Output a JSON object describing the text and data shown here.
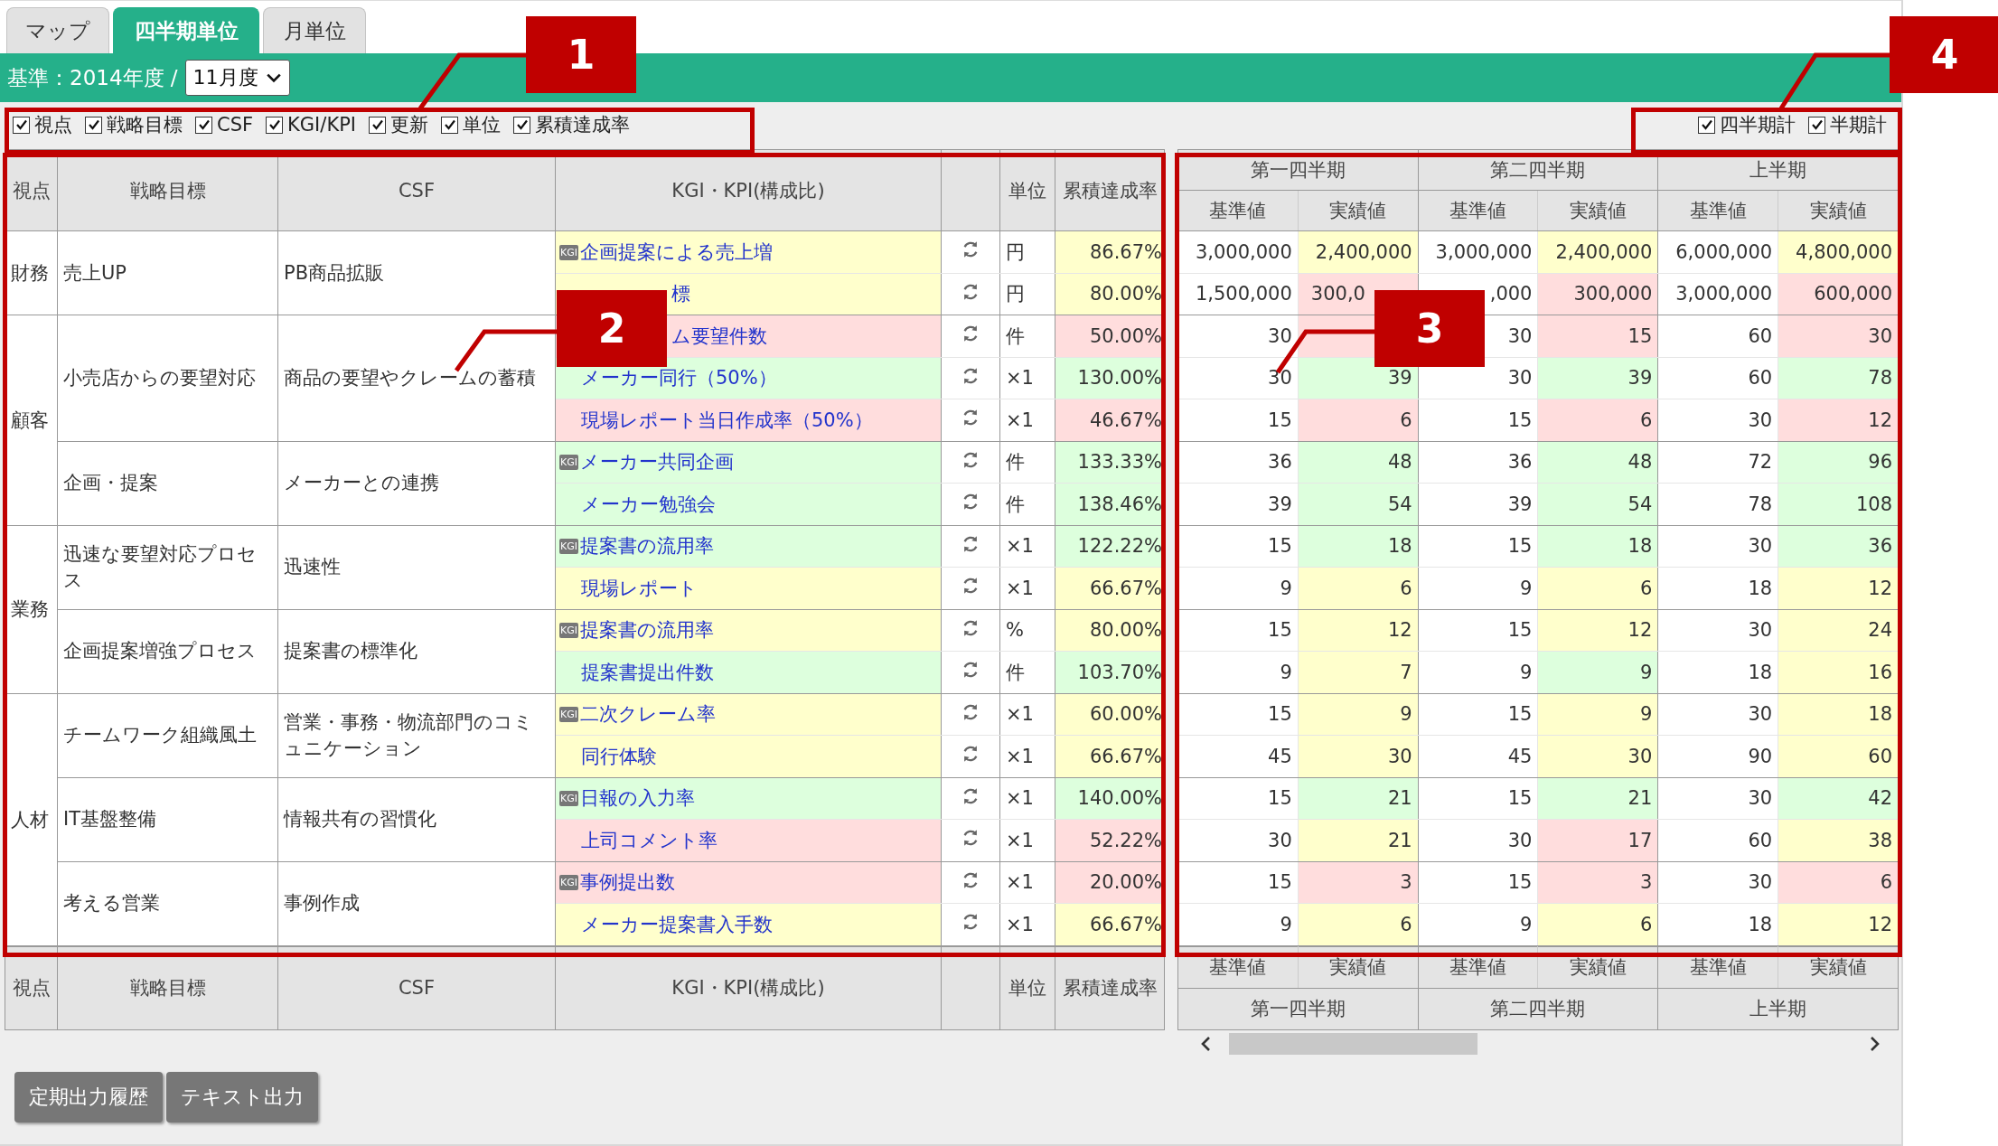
{
  "tabs": [
    {
      "label": "マップ",
      "selected": false
    },
    {
      "label": "四半期単位",
      "selected": true
    },
    {
      "label": "月単位",
      "selected": false
    }
  ],
  "basis": {
    "label": "基準：2014年度 /",
    "month": "11月度"
  },
  "display_options": [
    {
      "label": "視点",
      "checked": true
    },
    {
      "label": "戦略目標",
      "checked": true
    },
    {
      "label": "CSF",
      "checked": true
    },
    {
      "label": "KGI/KPI",
      "checked": true
    },
    {
      "label": "更新",
      "checked": true
    },
    {
      "label": "単位",
      "checked": true
    },
    {
      "label": "累積達成率",
      "checked": true
    }
  ],
  "total_options": [
    {
      "label": "四半期計",
      "checked": true
    },
    {
      "label": "半期計",
      "checked": true
    }
  ],
  "table": {
    "columns": [
      "視点",
      "戦略目標",
      "CSF",
      "KGI・KPI(構成比)",
      "単位",
      "累積達成率"
    ],
    "periods": [
      {
        "name": "第一四半期",
        "subcolumns": [
          "基準値",
          "実績値"
        ]
      },
      {
        "name": "第二四半期",
        "subcolumns": [
          "基準値",
          "実績値"
        ]
      },
      {
        "name": "上半期",
        "subcolumns": [
          "基準値",
          "実績値"
        ]
      }
    ],
    "perspectives": [
      {
        "name": "財務",
        "objectives": [
          {
            "name": "売上UP",
            "csf": "PB商品拡販",
            "kpis": [
              {
                "badge": "KGI",
                "name": "企画提案による売上増",
                "color": "#ffffcc",
                "unit": "円",
                "rate": "86.67%",
                "values": [
                  {
                    "text": "3,000,000"
                  },
                  {
                    "text": "2,400,000",
                    "color": "#ffffcc"
                  },
                  {
                    "text": "3,000,000"
                  },
                  {
                    "text": "2,400,000",
                    "color": "#ffffcc"
                  },
                  {
                    "text": "6,000,000"
                  },
                  {
                    "text": "4,800,000",
                    "color": "#ffffcc"
                  }
                ]
              },
              {
                "name": "標",
                "obscured": true,
                "color": "#ffffcc",
                "unit": "円",
                "rate": "80.00%",
                "values": [
                  {
                    "text": "1,500,000"
                  },
                  {
                    "text": "300,0",
                    "obscured": true,
                    "color": "#ffdddd"
                  },
                  {
                    "text": ",000"
                  },
                  {
                    "text": "300,000",
                    "color": "#ffdddd"
                  },
                  {
                    "text": "3,000,000"
                  },
                  {
                    "text": "600,000",
                    "color": "#ffdddd"
                  }
                ]
              }
            ]
          }
        ]
      },
      {
        "name": "顧客",
        "objectives": [
          {
            "name": "小売店からの要望対応",
            "csf": "商品の要望やクレームの蓄積",
            "kpis": [
              {
                "name": "ム要望件数",
                "obscured": true,
                "color": "#ffdddd",
                "unit": "件",
                "rate": "50.00%",
                "values": [
                  {
                    "text": "30"
                  },
                  {
                    "color": "#ffdddd"
                  },
                  {
                    "text": "30"
                  },
                  {
                    "text": "15",
                    "color": "#ffdddd"
                  },
                  {
                    "text": "60"
                  },
                  {
                    "text": "30",
                    "color": "#ffdddd"
                  }
                ]
              },
              {
                "name": "メーカー同行（50%）",
                "color": "#ddffdd",
                "unit": "×1",
                "rate": "130.00%",
                "values": [
                  {
                    "text": "30"
                  },
                  {
                    "text": "39",
                    "color": "#ddffdd"
                  },
                  {
                    "text": "30"
                  },
                  {
                    "text": "39",
                    "color": "#ddffdd"
                  },
                  {
                    "text": "60"
                  },
                  {
                    "text": "78",
                    "color": "#ddffdd"
                  }
                ]
              },
              {
                "name": "現場レポート当日作成率（50%）",
                "color": "#ffdddd",
                "unit": "×1",
                "rate": "46.67%",
                "values": [
                  {
                    "text": "15"
                  },
                  {
                    "text": "6",
                    "color": "#ffdddd"
                  },
                  {
                    "text": "15"
                  },
                  {
                    "text": "6",
                    "color": "#ffdddd"
                  },
                  {
                    "text": "30"
                  },
                  {
                    "text": "12",
                    "color": "#ffdddd"
                  }
                ]
              }
            ]
          },
          {
            "name": "企画・提案",
            "csf": "メーカーとの連携",
            "kpis": [
              {
                "badge": "KGI",
                "name": "メーカー共同企画",
                "color": "#ddffdd",
                "unit": "件",
                "rate": "133.33%",
                "values": [
                  {
                    "text": "36"
                  },
                  {
                    "text": "48",
                    "color": "#ddffdd"
                  },
                  {
                    "text": "36"
                  },
                  {
                    "text": "48",
                    "color": "#ddffdd"
                  },
                  {
                    "text": "72"
                  },
                  {
                    "text": "96",
                    "color": "#ddffdd"
                  }
                ]
              },
              {
                "name": "メーカー勉強会",
                "color": "#ddffdd",
                "unit": "件",
                "rate": "138.46%",
                "values": [
                  {
                    "text": "39"
                  },
                  {
                    "text": "54",
                    "color": "#ddffdd"
                  },
                  {
                    "text": "39"
                  },
                  {
                    "text": "54",
                    "color": "#ddffdd"
                  },
                  {
                    "text": "78"
                  },
                  {
                    "text": "108",
                    "color": "#ddffdd"
                  }
                ]
              }
            ]
          }
        ]
      },
      {
        "name": "業務",
        "objectives": [
          {
            "name": "迅速な要望対応プロセス",
            "csf": "迅速性",
            "kpis": [
              {
                "badge": "KGI",
                "name": "提案書の流用率",
                "color": "#ddffdd",
                "unit": "×1",
                "rate": "122.22%",
                "values": [
                  {
                    "text": "15"
                  },
                  {
                    "text": "18",
                    "color": "#ddffdd"
                  },
                  {
                    "text": "15"
                  },
                  {
                    "text": "18",
                    "color": "#ddffdd"
                  },
                  {
                    "text": "30"
                  },
                  {
                    "text": "36",
                    "color": "#ddffdd"
                  }
                ]
              },
              {
                "name": "現場レポート",
                "color": "#ffffcc",
                "unit": "×1",
                "rate": "66.67%",
                "values": [
                  {
                    "text": "9"
                  },
                  {
                    "text": "6",
                    "color": "#ffffcc"
                  },
                  {
                    "text": "9"
                  },
                  {
                    "text": "6",
                    "color": "#ffffcc"
                  },
                  {
                    "text": "18"
                  },
                  {
                    "text": "12",
                    "color": "#ffffcc"
                  }
                ]
              }
            ]
          },
          {
            "name": "企画提案増強プロセス",
            "csf": "提案書の標準化",
            "kpis": [
              {
                "badge": "KGI",
                "name": "提案書の流用率",
                "color": "#ffffcc",
                "unit": "%",
                "rate": "80.00%",
                "values": [
                  {
                    "text": "15"
                  },
                  {
                    "text": "12",
                    "color": "#ffffcc"
                  },
                  {
                    "text": "15"
                  },
                  {
                    "text": "12",
                    "color": "#ffffcc"
                  },
                  {
                    "text": "30"
                  },
                  {
                    "text": "24",
                    "color": "#ffffcc"
                  }
                ]
              },
              {
                "name": "提案書提出件数",
                "color": "#ddffdd",
                "unit": "件",
                "rate": "103.70%",
                "values": [
                  {
                    "text": "9"
                  },
                  {
                    "text": "7",
                    "color": "#ffffcc"
                  },
                  {
                    "text": "9"
                  },
                  {
                    "text": "9",
                    "color": "#ddffdd"
                  },
                  {
                    "text": "18"
                  },
                  {
                    "text": "16",
                    "color": "#ffffcc"
                  }
                ]
              }
            ]
          }
        ]
      },
      {
        "name": "人材",
        "objectives": [
          {
            "name": "チームワーク組織風土",
            "csf": "営業・事務・物流部門のコミュニケーション",
            "kpis": [
              {
                "badge": "KGI",
                "name": "二次クレーム率",
                "color": "#ffffcc",
                "unit": "×1",
                "rate": "60.00%",
                "values": [
                  {
                    "text": "15"
                  },
                  {
                    "text": "9",
                    "color": "#ffffcc"
                  },
                  {
                    "text": "15"
                  },
                  {
                    "text": "9",
                    "color": "#ffffcc"
                  },
                  {
                    "text": "30"
                  },
                  {
                    "text": "18",
                    "color": "#ffffcc"
                  }
                ]
              },
              {
                "name": "同行体験",
                "color": "#ffffcc",
                "unit": "×1",
                "rate": "66.67%",
                "values": [
                  {
                    "text": "45"
                  },
                  {
                    "text": "30",
                    "color": "#ffffcc"
                  },
                  {
                    "text": "45"
                  },
                  {
                    "text": "30",
                    "color": "#ffffcc"
                  },
                  {
                    "text": "90"
                  },
                  {
                    "text": "60",
                    "color": "#ffffcc"
                  }
                ]
              }
            ]
          },
          {
            "name": "IT基盤整備",
            "csf": "情報共有の習慣化",
            "kpis": [
              {
                "badge": "KGI",
                "name": "日報の入力率",
                "color": "#ddffdd",
                "unit": "×1",
                "rate": "140.00%",
                "values": [
                  {
                    "text": "15"
                  },
                  {
                    "text": "21",
                    "color": "#ddffdd"
                  },
                  {
                    "text": "15"
                  },
                  {
                    "text": "21",
                    "color": "#ddffdd"
                  },
                  {
                    "text": "30"
                  },
                  {
                    "text": "42",
                    "color": "#ddffdd"
                  }
                ]
              },
              {
                "name": "上司コメント率",
                "color": "#ffdddd",
                "unit": "×1",
                "rate": "52.22%",
                "values": [
                  {
                    "text": "30"
                  },
                  {
                    "text": "21",
                    "color": "#ffffcc"
                  },
                  {
                    "text": "30"
                  },
                  {
                    "text": "17",
                    "color": "#ffdddd"
                  },
                  {
                    "text": "60"
                  },
                  {
                    "text": "38",
                    "color": "#ffffcc"
                  }
                ]
              }
            ]
          },
          {
            "name": "考える営業",
            "csf": "事例作成",
            "kpis": [
              {
                "badge": "KGI",
                "name": "事例提出数",
                "color": "#ffdddd",
                "unit": "×1",
                "rate": "20.00%",
                "values": [
                  {
                    "text": "15"
                  },
                  {
                    "text": "3",
                    "color": "#ffdddd"
                  },
                  {
                    "text": "15"
                  },
                  {
                    "text": "3",
                    "color": "#ffdddd"
                  },
                  {
                    "text": "30"
                  },
                  {
                    "text": "6",
                    "color": "#ffdddd"
                  }
                ]
              },
              {
                "name": "メーカー提案書入手数",
                "color": "#ffffcc",
                "unit": "×1",
                "rate": "66.67%",
                "values": [
                  {
                    "text": "9"
                  },
                  {
                    "text": "6",
                    "color": "#ffffcc"
                  },
                  {
                    "text": "9"
                  },
                  {
                    "text": "6",
                    "color": "#ffffcc"
                  },
                  {
                    "text": "18"
                  },
                  {
                    "text": "12",
                    "color": "#ffffcc"
                  }
                ]
              }
            ]
          }
        ]
      }
    ]
  },
  "footer": {
    "columns": [
      "視点",
      "戦略目標",
      "CSF",
      "KGI・KPI(構成比)",
      "単位",
      "累積達成率"
    ],
    "periods": [
      {
        "name": "第一四半期",
        "subcolumns": [
          "基準値",
          "実績値"
        ]
      },
      {
        "name": "第二四半期",
        "subcolumns": [
          "基準値",
          "実績値"
        ]
      },
      {
        "name": "上半期",
        "subcolumns": [
          "基準値",
          "実績値"
        ]
      }
    ]
  },
  "buttons": [
    "定期出力履歴",
    "テキスト出力"
  ],
  "callouts": [
    {
      "number": "1"
    },
    {
      "number": "2"
    },
    {
      "number": "3"
    },
    {
      "number": "4"
    }
  ]
}
